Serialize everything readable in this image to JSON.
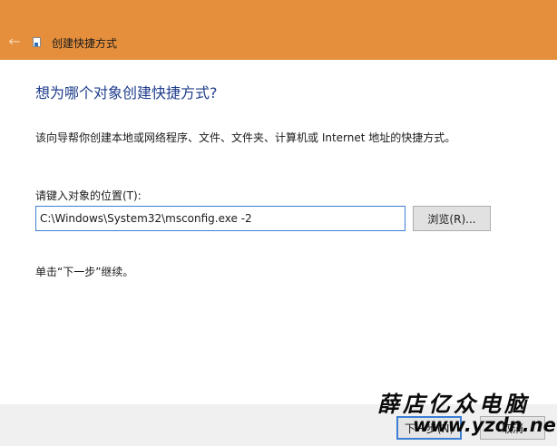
{
  "window": {
    "title": "创建快捷方式",
    "back_icon": "arrow-left-icon",
    "app_icon": "shortcut-icon",
    "accent_color": "#e58f3d"
  },
  "main": {
    "heading": "想为哪个对象创建快捷方式?",
    "description": "该向导帮你创建本地或网络程序、文件、文件夹、计算机或 Internet 地址的快捷方式。",
    "location_label": "请键入对象的位置(T):",
    "location_value": "C:\\Windows\\System32\\msconfig.exe -2",
    "browse_label": "浏览(R)...",
    "hint": "单击“下一步”继续。"
  },
  "footer": {
    "next_label": "下一步(N)",
    "cancel_label": "取消"
  },
  "watermark": {
    "name": "薛店亿众电脑",
    "url": "www.yzdn.net"
  }
}
